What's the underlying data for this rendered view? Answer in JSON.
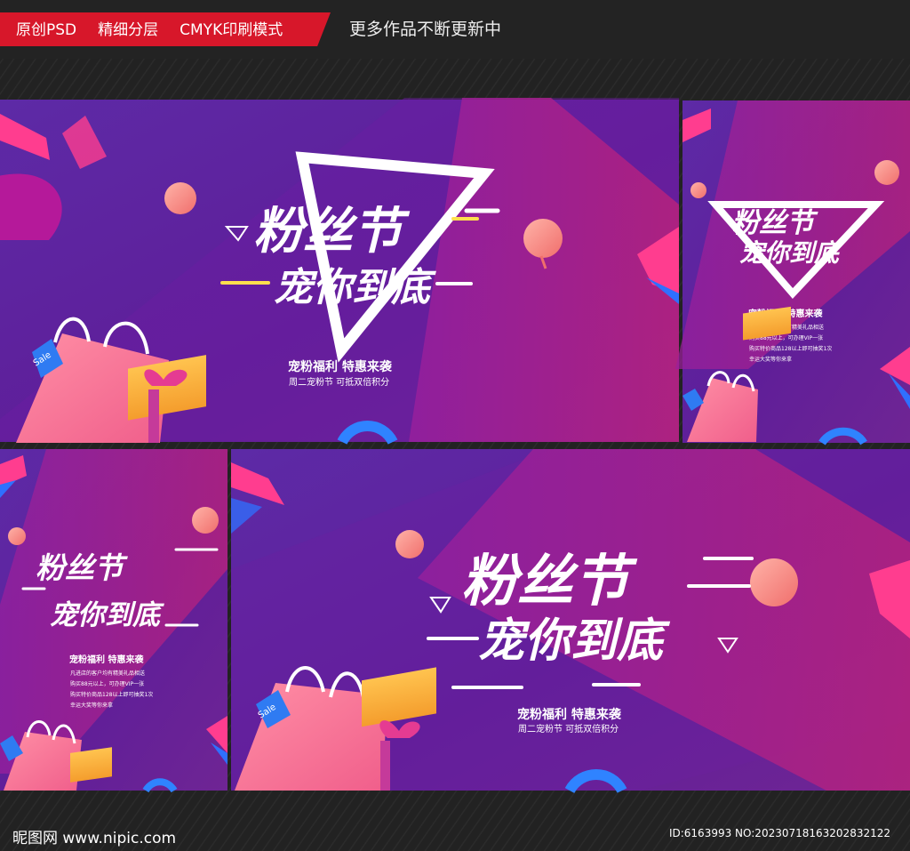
{
  "header": {
    "tags": [
      "原创PSD",
      "精细分层",
      "CMYK印刷模式"
    ],
    "more": "更多作品不断更新中"
  },
  "poster": {
    "title": "粉丝节",
    "subtitle": "宠你到底",
    "slogan": "宠粉福利 特惠来袭",
    "slogan2": "周二宠粉节 可抵双倍积分",
    "details": [
      "凡进店的客户均有精美礼品相送",
      "购买88元以上，可办理VIP一张",
      "购买特价商品128以上即可抽奖1次",
      "幸运大奖等你来拿"
    ],
    "sale": "Sale"
  },
  "footer": {
    "site": "昵图网 www.nipic.com",
    "id": "ID:6163993 NO:20230718163202832122"
  },
  "colors": {
    "purple": "#5b239c",
    "magenta": "#b81c87",
    "pink": "#ef5b83",
    "gold": "#f6a534",
    "blue": "#2f70ff"
  }
}
